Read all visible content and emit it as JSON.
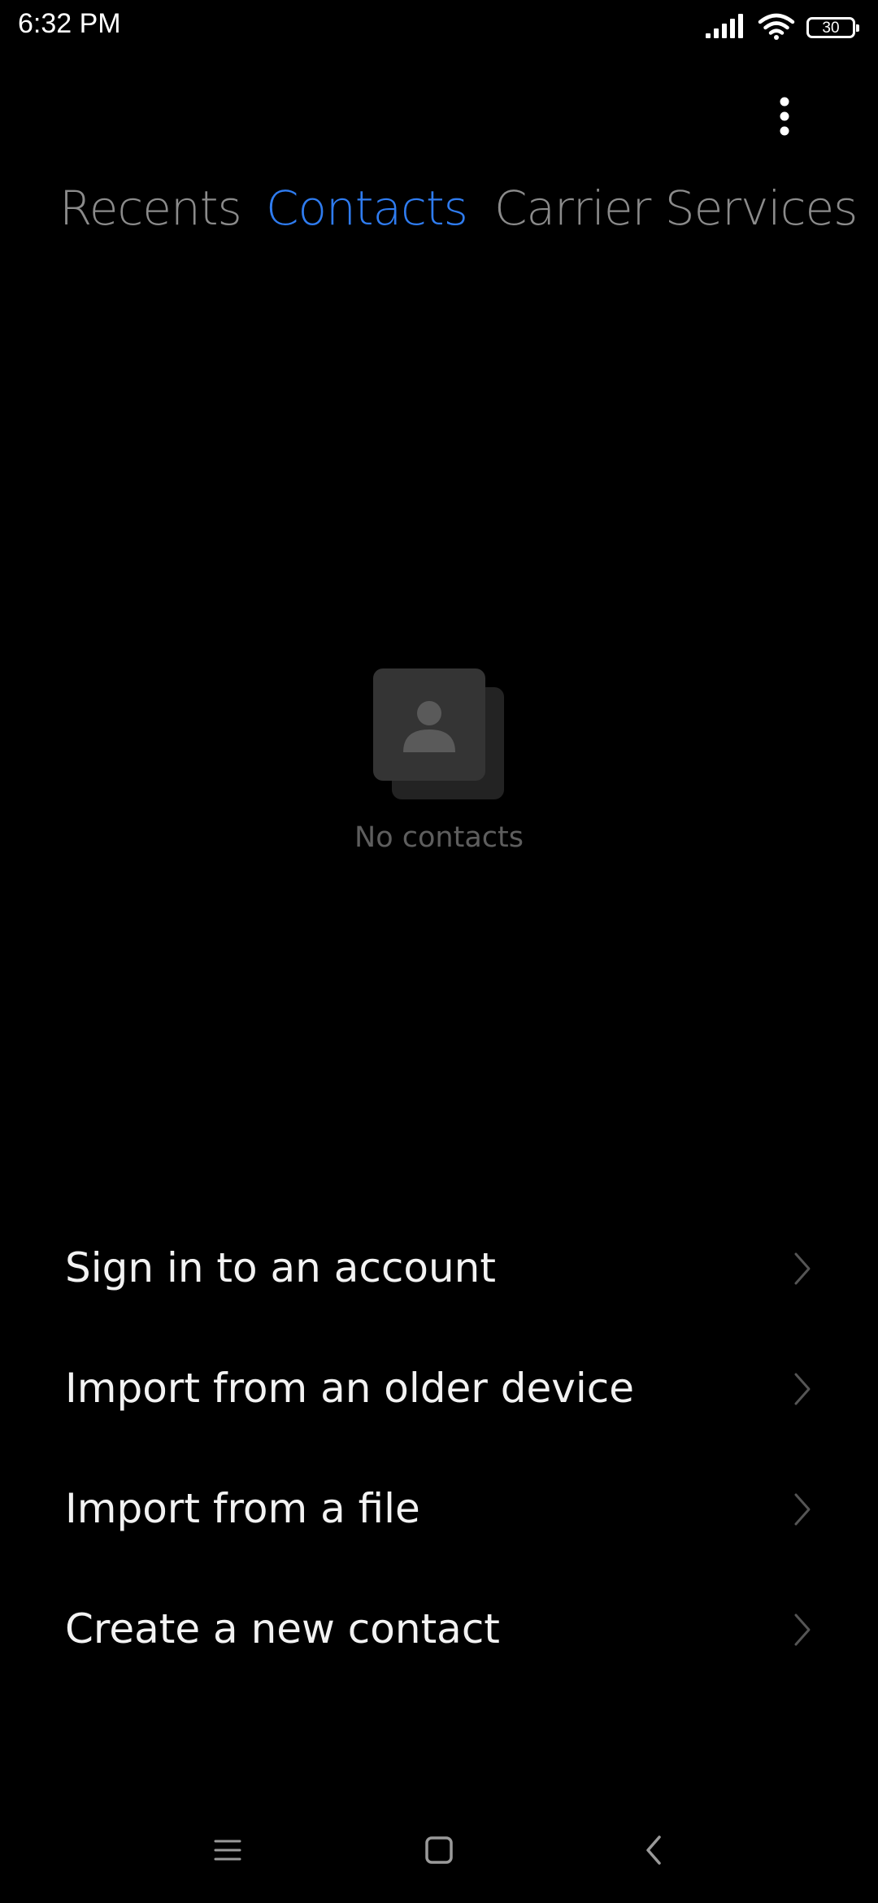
{
  "status_bar": {
    "time": "6:32 PM",
    "battery_level": "30",
    "icons": [
      "signal-icon",
      "wifi-icon",
      "battery-icon"
    ]
  },
  "tabs": [
    {
      "label": "Recents",
      "active": false
    },
    {
      "label": "Contacts",
      "active": true
    },
    {
      "label": "Carrier Services",
      "active": false
    }
  ],
  "empty_state": {
    "text": "No contacts",
    "icon": "contact-card-icon"
  },
  "actions": [
    {
      "label": "Sign in to an account"
    },
    {
      "label": "Import from an older device"
    },
    {
      "label": "Import from a file"
    },
    {
      "label": "Create a new contact"
    }
  ],
  "nav_bar": {
    "icons": [
      "recent-apps-icon",
      "home-icon",
      "back-icon"
    ]
  },
  "colors": {
    "background": "#000000",
    "active_tab": "#2f7cf0",
    "inactive_tab": "#8b8b8b",
    "action_text": "#f2f2f2",
    "muted_text": "#5e5e5e"
  }
}
